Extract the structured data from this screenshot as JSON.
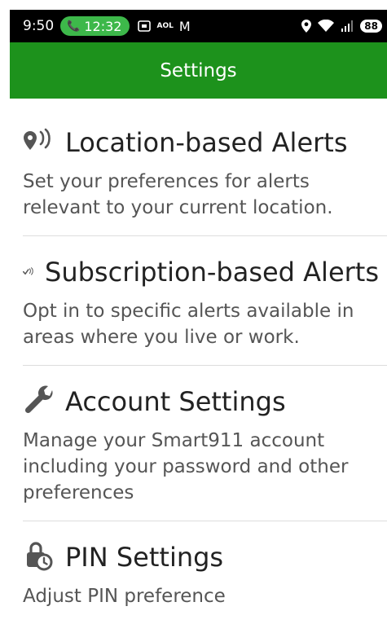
{
  "status_bar": {
    "time": "9:50",
    "call_time": "12:32",
    "left_icons": [
      "screencast-icon",
      "aol-icon",
      "gmail-icon"
    ],
    "aol": "AOL",
    "gmail": "M",
    "battery": "88"
  },
  "app_bar": {
    "title": "Settings"
  },
  "items": [
    {
      "icon": "location-alert-icon",
      "title": "Location-based Alerts",
      "desc": "Set your preferences for alerts relevant to your current location."
    },
    {
      "icon": "checkmark-alert-icon",
      "title": "Subscription-based Alerts",
      "desc": "Opt in to specific alerts available in areas where you live or work."
    },
    {
      "icon": "wrench-icon",
      "title": "Account Settings",
      "desc": "Manage your Smart911 account including your password and other preferences"
    },
    {
      "icon": "pin-lock-icon",
      "title": "PIN Settings",
      "desc": "Adjust PIN preference"
    }
  ],
  "colors": {
    "app_bar": "#1d921c",
    "call_pill": "#3db84a",
    "title_text": "#222222",
    "desc_text": "#555555"
  }
}
